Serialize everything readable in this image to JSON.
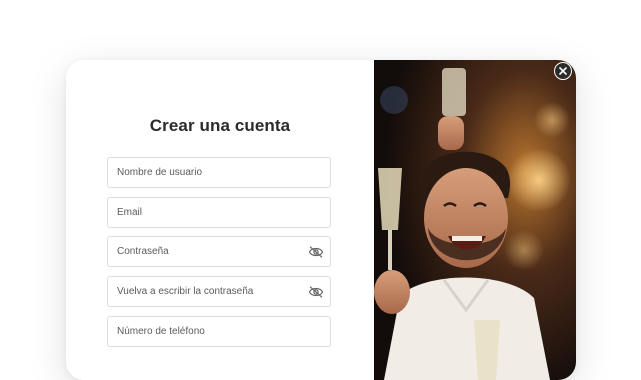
{
  "signup": {
    "title": "Crear una cuenta",
    "fields": {
      "username": {
        "placeholder": "Nombre de usuario"
      },
      "email": {
        "placeholder": "Email"
      },
      "password": {
        "placeholder": "Contraseña"
      },
      "confirm_password": {
        "placeholder": "Vuelva a escribir la contraseña"
      },
      "phone": {
        "placeholder": "Número de teléfono"
      }
    }
  },
  "icons": {
    "password_toggle": "eye-off-icon",
    "close": "close-icon"
  },
  "colors": {
    "title": "#2b2b2b",
    "field_border": "#dcdcdc",
    "close_bg": "#2b2b2b"
  }
}
